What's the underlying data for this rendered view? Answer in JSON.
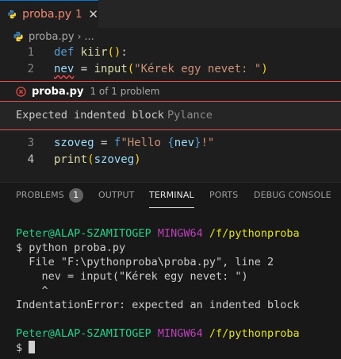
{
  "tab": {
    "filename": "proba.py",
    "problem_count": "1",
    "close_glyph": "✕"
  },
  "breadcrumb": {
    "filename": "proba.py",
    "separator": "›",
    "ellipsis": "..."
  },
  "editor_top": [
    {
      "num": "1",
      "tokens": [
        [
          "kw",
          "def"
        ],
        [
          "op",
          " "
        ],
        [
          "fn",
          "kiir"
        ],
        [
          "br",
          "()"
        ],
        [
          "op",
          ":"
        ]
      ]
    },
    {
      "num": "2",
      "tokens": [
        [
          "var squiggle",
          "nev"
        ],
        [
          "op",
          " = "
        ],
        [
          "fn",
          "input"
        ],
        [
          "br",
          "("
        ],
        [
          "str",
          "\"Kérek egy nevet: \""
        ],
        [
          "br",
          ")"
        ]
      ]
    }
  ],
  "peek": {
    "filename": "proba.py",
    "count_text": "1 of 1 problem",
    "message": "Expected indented block",
    "source": "Pylance"
  },
  "editor_bottom": [
    {
      "num": "3",
      "active": false,
      "tokens": [
        [
          "var",
          "szoveg"
        ],
        [
          "op",
          " = "
        ],
        [
          "kw",
          "f"
        ],
        [
          "str",
          "\"Hello "
        ],
        [
          "kw",
          "{"
        ],
        [
          "var",
          "nev"
        ],
        [
          "kw",
          "}"
        ],
        [
          "str",
          "!\""
        ]
      ]
    },
    {
      "num": "4",
      "active": true,
      "tokens": [
        [
          "fn",
          "print"
        ],
        [
          "br",
          "("
        ],
        [
          "var",
          "szoveg"
        ],
        [
          "br",
          ")"
        ]
      ]
    }
  ],
  "panel": {
    "tabs": [
      {
        "label": "PROBLEMS",
        "badge": "1"
      },
      {
        "label": "OUTPUT"
      },
      {
        "label": "TERMINAL",
        "active": true
      },
      {
        "label": "PORTS"
      },
      {
        "label": "DEBUG CONSOLE"
      }
    ]
  },
  "terminal": {
    "prompt_user": "Peter@ALAP-SZAMITOGEP",
    "prompt_env": "MINGW64",
    "prompt_path": "/f/pythonproba",
    "command_line": "$ python proba.py",
    "trace": [
      "  File \"F:\\pythonproba\\proba.py\", line 2",
      "    nev = input(\"Kérek egy nevet: \")",
      "    ^",
      "IndentationError: expected an indented block"
    ],
    "prompt_symbol": "$ "
  },
  "colors": {
    "accent": "#0078d4",
    "error": "#f14c4c",
    "terminal_green": "#23d18b",
    "terminal_magenta": "#bc3fbc",
    "terminal_yellow": "#e5e510"
  },
  "icons": {
    "python": "python-file-icon",
    "error": "error-circle-icon"
  }
}
